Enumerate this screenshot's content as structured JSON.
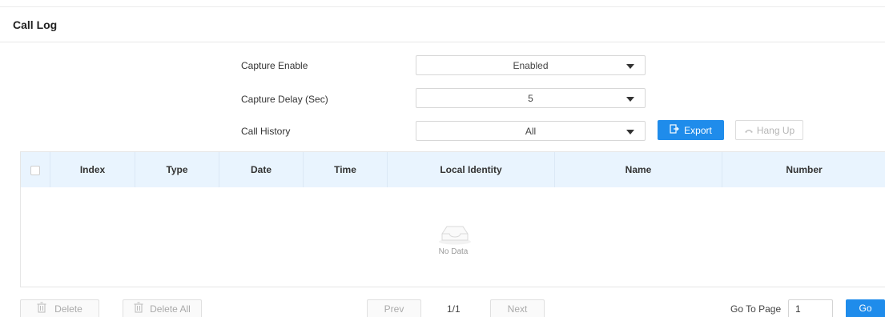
{
  "section": {
    "title": "Call Log"
  },
  "form": {
    "capture_enable": {
      "label": "Capture Enable",
      "value": "Enabled"
    },
    "capture_delay": {
      "label": "Capture Delay (Sec)",
      "value": "5"
    },
    "call_history": {
      "label": "Call History",
      "value": "All"
    }
  },
  "actions": {
    "export_label": "Export",
    "hangup_label": "Hang Up"
  },
  "table": {
    "columns": [
      "Index",
      "Type",
      "Date",
      "Time",
      "Local Identity",
      "Name",
      "Number"
    ],
    "empty_text": "No Data"
  },
  "footer": {
    "delete_label": "Delete",
    "delete_all_label": "Delete All",
    "prev_label": "Prev",
    "page_indicator": "1/1",
    "next_label": "Next",
    "goto_label": "Go To Page",
    "goto_value": "1",
    "go_label": "Go"
  },
  "colors": {
    "accent": "#1f8ceb",
    "header_bg": "#e9f4fe"
  },
  "icons": {
    "export": "export-icon",
    "hangup": "hang-up-icon",
    "trash": "trash-icon",
    "empty": "empty-box-icon"
  }
}
